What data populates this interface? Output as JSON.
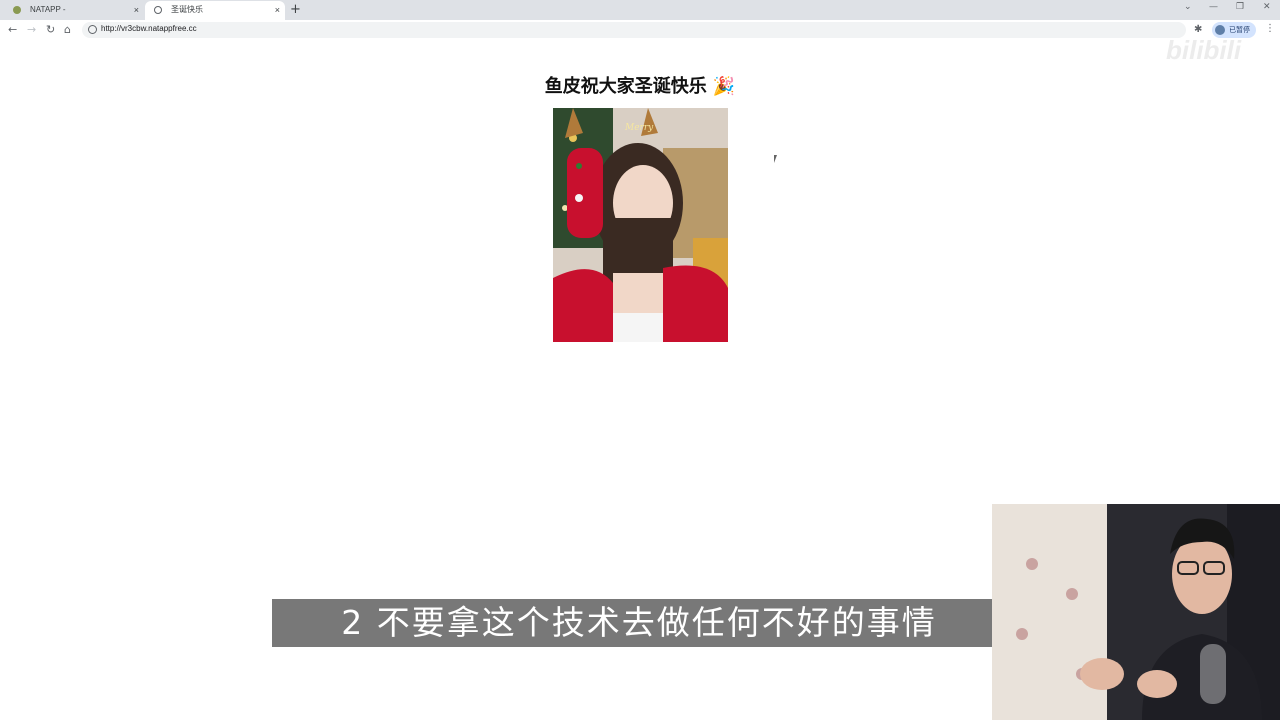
{
  "browser": {
    "tabs": [
      {
        "title": "NATAPP -",
        "active": false
      },
      {
        "title": "圣诞快乐",
        "active": true
      }
    ],
    "new_tab_symbol": "+",
    "close_symbol": "×",
    "url": "http://vr3cbw.natappfree.cc",
    "profile_label": "已暂停",
    "window_controls": [
      "⌄",
      "—",
      "❐",
      "✕"
    ]
  },
  "watermark": "bilibili",
  "page": {
    "title": "鱼皮祝大家圣诞快乐",
    "title_emoji": "🎉",
    "photo_text": "Merry"
  },
  "subtitle": "2 不要拿这个技术去做任何不好的事情",
  "colors": {
    "tabstrip": "#dee1e6",
    "omnibox": "#f1f3f4",
    "subtitle_bg": "#5a5a5a",
    "photo_red": "#c8102e"
  }
}
